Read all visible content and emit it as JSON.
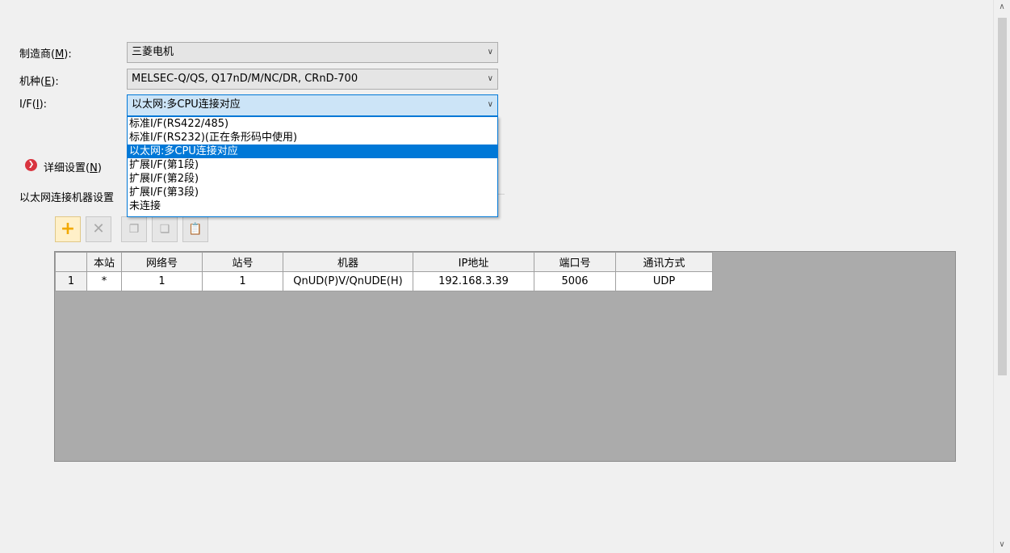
{
  "form": {
    "maker_label": "制造商(",
    "maker_key": "M",
    "maker_suffix": "):",
    "maker_value": "三菱电机",
    "model_label": "机种(",
    "model_key": "E",
    "model_suffix": "):",
    "model_value": "MELSEC-Q/QS, Q17nD/M/NC/DR, CRnD-700",
    "if_label": "I/F(",
    "if_key": "I",
    "if_suffix": "):",
    "if_value": "以太网:多CPU连接对应"
  },
  "dropdown": {
    "options": [
      "标准I/F(RS422/485)",
      "标准I/F(RS232)(正在条形码中使用)",
      "以太网:多CPU连接对应",
      "扩展I/F(第1段)",
      "扩展I/F(第2段)",
      "扩展I/F(第3段)",
      "未连接"
    ],
    "selected_index": 2
  },
  "detail": {
    "label": "详细设置(",
    "key": "N",
    "suffix": ")"
  },
  "section_label": "以太网连接机器设置",
  "toolbar": {
    "add_icon": "add-icon",
    "delete_icon": "delete-icon",
    "copy_icon": "copy-icon",
    "paste_icon": "paste-icon",
    "clipboard_icon": "clipboard-icon"
  },
  "grid": {
    "headers": [
      "",
      "本站",
      "网络号",
      "站号",
      "机器",
      "IP地址",
      "端口号",
      "通讯方式"
    ],
    "rows": [
      [
        "1",
        "*",
        "1",
        "1",
        "QnUD(P)V/QnUDE(H)",
        "192.168.3.39",
        "5006",
        "UDP"
      ]
    ]
  },
  "colors": {
    "accent": "#0078d7",
    "grid_bg": "#ababab",
    "detail_icon": "#d9343f"
  }
}
